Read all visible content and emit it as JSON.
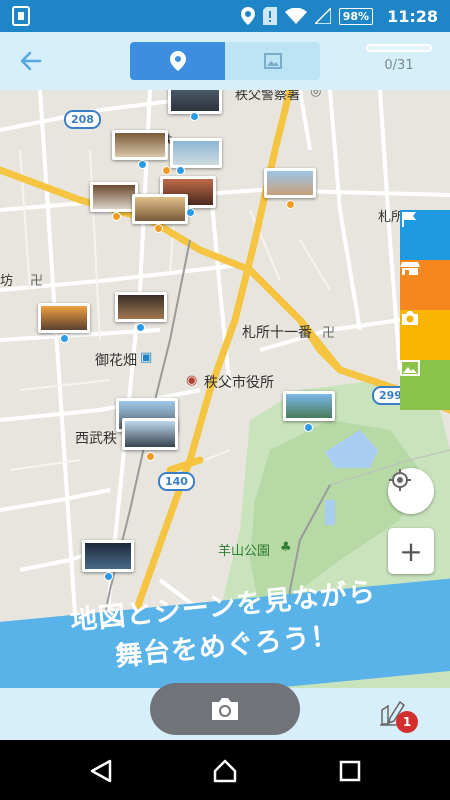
{
  "status_bar": {
    "battery": "98%",
    "time": "11:28",
    "icons": [
      "upload-icon",
      "location-icon",
      "sim-alert-icon",
      "wifi-icon",
      "signal-icon",
      "battery-icon"
    ]
  },
  "header": {
    "back_icon": "arrow-left-icon",
    "mode_tabs": [
      {
        "name": "map",
        "icon": "map-pin-icon",
        "active": true
      },
      {
        "name": "photos",
        "icon": "image-icon",
        "active": false
      }
    ],
    "progress": {
      "current": 0,
      "total": 31,
      "text": "0/31",
      "fraction": 0
    }
  },
  "map": {
    "labels": {
      "chichibu_station_top": "秩父警察署",
      "chichibu_short": "秩",
      "fudasho_11": "札所十一番",
      "hanabatake": "御花畑",
      "city_hall": "秩父市役所",
      "seibu": "西武秩",
      "hitsujiyama": "羊山公園",
      "fudasho_right": "札所",
      "left_edge": "坊"
    },
    "routes": [
      "208",
      "299",
      "140"
    ],
    "side_buttons": [
      {
        "icon": "flag-icon",
        "color": "#1e9be0"
      },
      {
        "icon": "shop-icon",
        "color": "#f5871f"
      },
      {
        "icon": "camera-icon",
        "color": "#f7b500"
      },
      {
        "icon": "image-icon",
        "color": "#8bc34a"
      }
    ],
    "controls": {
      "locate_icon": "crosshair-icon",
      "zoom_in": "+"
    }
  },
  "banner": {
    "line1": "地図とシーンを見ながら",
    "line2": "舞台をめぐろう！"
  },
  "bottom": {
    "camera_icon": "camera-icon",
    "edit_icon": "edit-icon",
    "notification_count": "1"
  },
  "navigation": {
    "back": "nav-back-icon",
    "home": "nav-home-icon",
    "recent": "nav-recent-icon"
  },
  "colors": {
    "primary": "#1e86c7",
    "accent": "#3d8de0",
    "header_bg": "#d7effa",
    "banner": "#5ab3e8"
  }
}
